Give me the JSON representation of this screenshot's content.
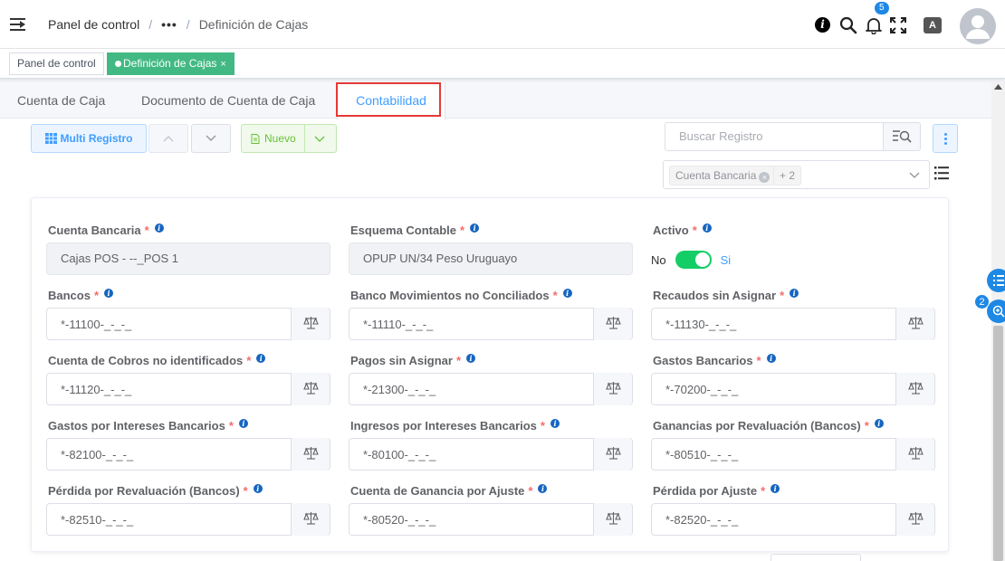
{
  "header": {
    "breadcrumb": {
      "home": "Panel de control",
      "sep1": "/",
      "ellipsis": "•••",
      "sep2": "/",
      "current": "Definición de Cajas"
    },
    "notifications_count": "5",
    "lang_label": "A",
    "icons": [
      "menu-toggle-icon",
      "info-icon",
      "search-icon",
      "bell-icon",
      "fullscreen-icon",
      "language-icon",
      "avatar-icon"
    ]
  },
  "tags": {
    "home": "Panel de control",
    "active": "Definición de Cajas",
    "close": "×"
  },
  "tabs": [
    "Cuenta de Caja",
    "Documento de Cuenta de Caja",
    "Contabilidad"
  ],
  "active_tab": "Contabilidad",
  "toolbar": {
    "multi_registro": "Multi Registro",
    "nuevo": "Nuevo",
    "search_placeholder": "Buscar Registro",
    "filter_chip": "Cuenta Bancaria",
    "filter_more": "+ 2"
  },
  "form": {
    "cuenta_bancaria": {
      "label": "Cuenta Bancaria",
      "value": "Cajas POS - --_POS 1"
    },
    "esquema_contable": {
      "label": "Esquema Contable",
      "value": "OPUP UN/34 Peso Uruguayo"
    },
    "activo": {
      "label": "Activo",
      "off_label": "No",
      "on_label": "Si",
      "value": true
    },
    "bancos": {
      "label": "Bancos",
      "value": "*-11100-_-_-_"
    },
    "banco_mov_no_conc": {
      "label": "Banco Movimientos no Conciliados",
      "value": "*-11110-_-_-_"
    },
    "recaudos_sin_asignar": {
      "label": "Recaudos sin Asignar",
      "value": "*-11130-_-_-_"
    },
    "cuenta_cobros_no_id": {
      "label": "Cuenta de Cobros no identificados",
      "value": "*-11120-_-_-_"
    },
    "pagos_sin_asignar": {
      "label": "Pagos sin Asignar",
      "value": "*-21300-_-_-_"
    },
    "gastos_bancarios": {
      "label": "Gastos Bancarios",
      "value": "*-70200-_-_-_"
    },
    "gastos_intereses": {
      "label": "Gastos por Intereses Bancarios",
      "value": "*-82100-_-_-_"
    },
    "ingresos_intereses": {
      "label": "Ingresos por Intereses Bancarios",
      "value": "*-80100-_-_-_"
    },
    "ganancias_revaluacion": {
      "label": "Ganancias por Revaluación (Bancos)",
      "value": "*-80510-_-_-_"
    },
    "perdida_revaluacion": {
      "label": "Pérdida por Revaluación (Bancos)",
      "value": "*-82510-_-_-_"
    },
    "ganancia_ajuste": {
      "label": "Cuenta de Ganancia por Ajuste",
      "value": "*-80520-_-_-_"
    },
    "perdida_ajuste": {
      "label": "Pérdida por Ajuste",
      "value": "*-82520-_-_-_"
    },
    "required_mark": "*"
  },
  "floating": {
    "badge": "2"
  },
  "colors": {
    "accent": "#409eff",
    "success": "#42b983",
    "switch_on": "#13ce66",
    "required": "#f56c6c",
    "highlight": "#e53935"
  }
}
